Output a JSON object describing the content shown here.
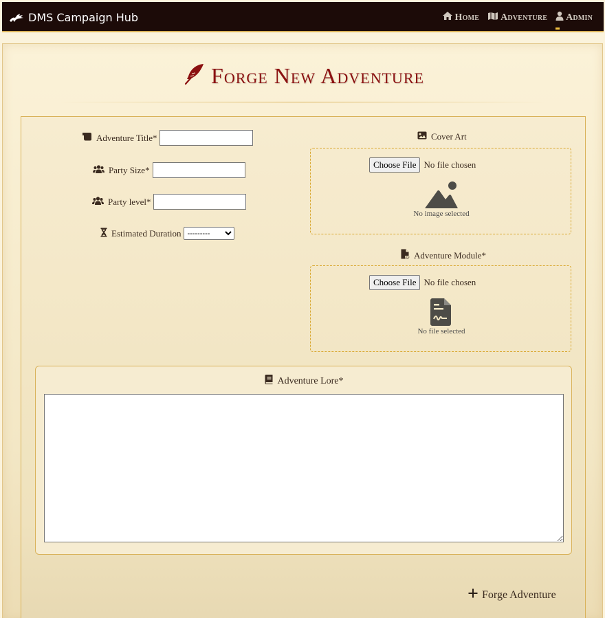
{
  "nav": {
    "brand": "DMS Campaign Hub",
    "links": [
      {
        "label": "Home",
        "icon": "home-icon"
      },
      {
        "label": "Adventure",
        "icon": "map-icon"
      },
      {
        "label": "Admin",
        "icon": "user-icon"
      }
    ]
  },
  "page": {
    "title": "Forge New Adventure",
    "title_color": "#8b1010"
  },
  "form": {
    "adventure_title_label": "Adventure Title*",
    "adventure_title_value": "",
    "party_size_label": "Party Size*",
    "party_size_value": "",
    "party_level_label": "Party level*",
    "party_level_value": "",
    "duration_label": "Estimated Duration",
    "duration_selected": "---------",
    "cover_art_label": "Cover Art",
    "cover_choose": "Choose File",
    "cover_status": "No file chosen",
    "cover_caption": "No image selected",
    "module_label": "Adventure Module*",
    "module_choose": "Choose File",
    "module_status": "No file chosen",
    "module_caption": "No file selected",
    "lore_label": "Adventure Lore*",
    "lore_value": "",
    "submit_label": "Forge Adventure"
  }
}
